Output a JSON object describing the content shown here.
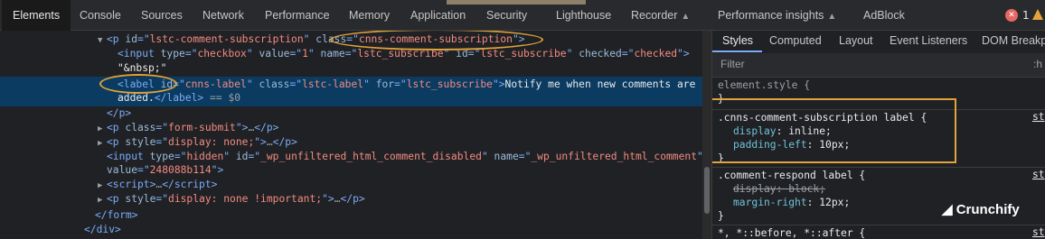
{
  "tabs": [
    "Elements",
    "Console",
    "Sources",
    "Network",
    "Performance",
    "Memory",
    "Application",
    "Security",
    "Lighthouse",
    "Recorder",
    "Performance insights",
    "AdBlock"
  ],
  "badges": {
    "errors": "1"
  },
  "dom": {
    "l1": {
      "id": "lstc-comment-subscription",
      "class": "cnns-comment-subscription"
    },
    "l2": {
      "type": "checkbox",
      "value": "1",
      "name": "lstc_subscribe",
      "id": "lstc_subscribe",
      "checked": "checked"
    },
    "l3": "\"&nbsp;\"",
    "l4": {
      "id": "cnns-label",
      "class": "lstc-label",
      "for": "lstc_subscribe",
      "text1": "Notify me when new comments are",
      "text2": "added.",
      "eq": "== $0"
    },
    "l6": {
      "class": "form-submit"
    },
    "l7": {
      "style": "display: none;"
    },
    "l8": {
      "type": "hidden",
      "id": "_wp_unfiltered_html_comment_disabled",
      "name": "_wp_unfiltered_html_comment",
      "value": "248088b114"
    },
    "l10": {
      "style": "display: none !important;"
    }
  },
  "styles": {
    "tabs": [
      "Styles",
      "Computed",
      "Layout",
      "Event Listeners",
      "DOM Breakpo"
    ],
    "filter_placeholder": "Filter",
    "hov": ":h",
    "element_style": "element.style {",
    "close": "}",
    "rule1": {
      "selector": ".cnns-comment-subscription label {",
      "p1": "display",
      "v1": "inline;",
      "p2": "padding-left",
      "v2": "10px;",
      "src": "st"
    },
    "rule2": {
      "selector": ".comment-respond label {",
      "p1": "display",
      "v1": "block;",
      "p2": "margin-right",
      "v2": "12px;",
      "src": "st"
    },
    "rule3": {
      "selector": "*, *::before, *::after {",
      "src": "st"
    },
    "brand": "Crunchify"
  }
}
